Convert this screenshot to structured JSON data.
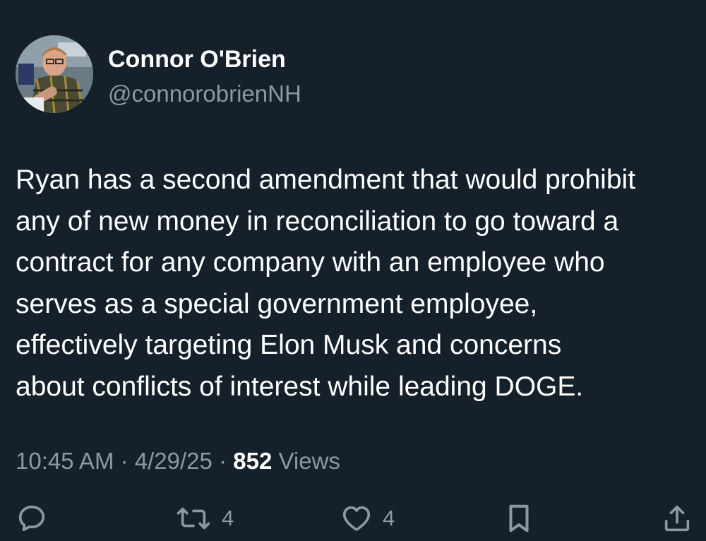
{
  "author": {
    "display_name": "Connor O'Brien",
    "handle": "@connorobrienNH"
  },
  "tweet": {
    "lines": [
      "Ryan has a second amendment that would prohibit",
      "any of new money in reconciliation to go toward a",
      "contract for any company with an employee who",
      "serves as a special government employee,",
      "effectively targeting Elon Musk and concerns",
      "about conflicts of interest while leading DOGE."
    ]
  },
  "meta": {
    "time": "10:45 AM",
    "separator": "·",
    "date": "4/29/25",
    "views_count": "852",
    "views_label": "Views"
  },
  "actions": {
    "reply_icon": "reply-icon",
    "retweet_icon": "retweet-icon",
    "retweet_count": "4",
    "like_icon": "heart-icon",
    "like_count": "4",
    "bookmark_icon": "bookmark-icon",
    "share_icon": "share-icon"
  },
  "colors": {
    "background": "#15202b",
    "primary_text": "#ffffff",
    "secondary_text": "#8b98a5"
  }
}
